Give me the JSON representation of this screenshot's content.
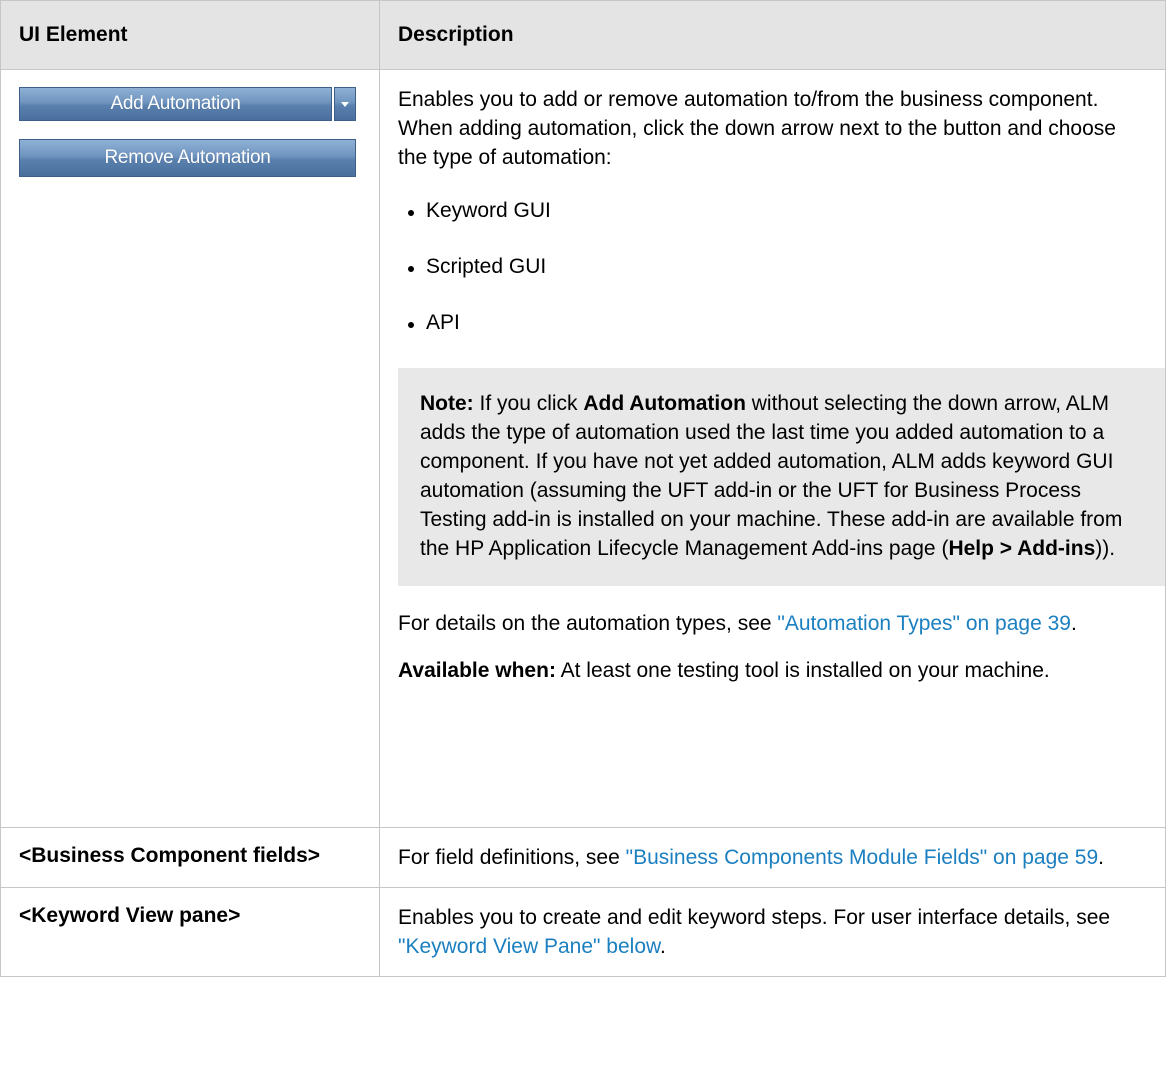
{
  "table": {
    "header": {
      "col1": "UI Element",
      "col2": "Description"
    },
    "rows": {
      "automation": {
        "add_button_label": "Add Automation",
        "remove_button_label": "Remove Automation",
        "intro": "Enables you to add or remove automation to/from the business component. When adding automation, click the down arrow next to the button and choose the type of automation:",
        "types": [
          "Keyword GUI",
          "Scripted GUI",
          "API"
        ],
        "note": {
          "label": "Note:",
          "text_1": " If you click ",
          "bold_1": "Add Automation",
          "text_2": " without selecting the down arrow, ALM adds the type of automation used the last time you added automation to a component. If you have not yet added automation, ALM adds keyword GUI automation (assuming the UFT add-in or the UFT for Business Process Testing add-in is installed on your machine. These add-in are available from the HP Application Lifecycle Management Add-ins page (",
          "bold_2": "Help > Add-ins",
          "text_3": "))."
        },
        "details": {
          "prefix": "For details on the automation types, see ",
          "link": "\"Automation Types\" on page 39",
          "suffix": "."
        },
        "available": {
          "label": "Available when:",
          "text": " At least one testing tool is installed on your machine."
        }
      },
      "fields": {
        "element": "<Business Component fields>",
        "prefix": "For field definitions, see ",
        "link": "\"Business Components Module Fields\" on page 59",
        "suffix": "."
      },
      "keyword_view": {
        "element": "<Keyword View pane>",
        "prefix": "Enables you to create and edit keyword steps. For user interface details, see ",
        "link": "\"Keyword View Pane\" below",
        "suffix": "."
      }
    }
  },
  "colors": {
    "header_bg": "#e4e4e4",
    "note_bg": "#e8e8e8",
    "link": "#1b7fc0",
    "button": "#5a80ae"
  }
}
